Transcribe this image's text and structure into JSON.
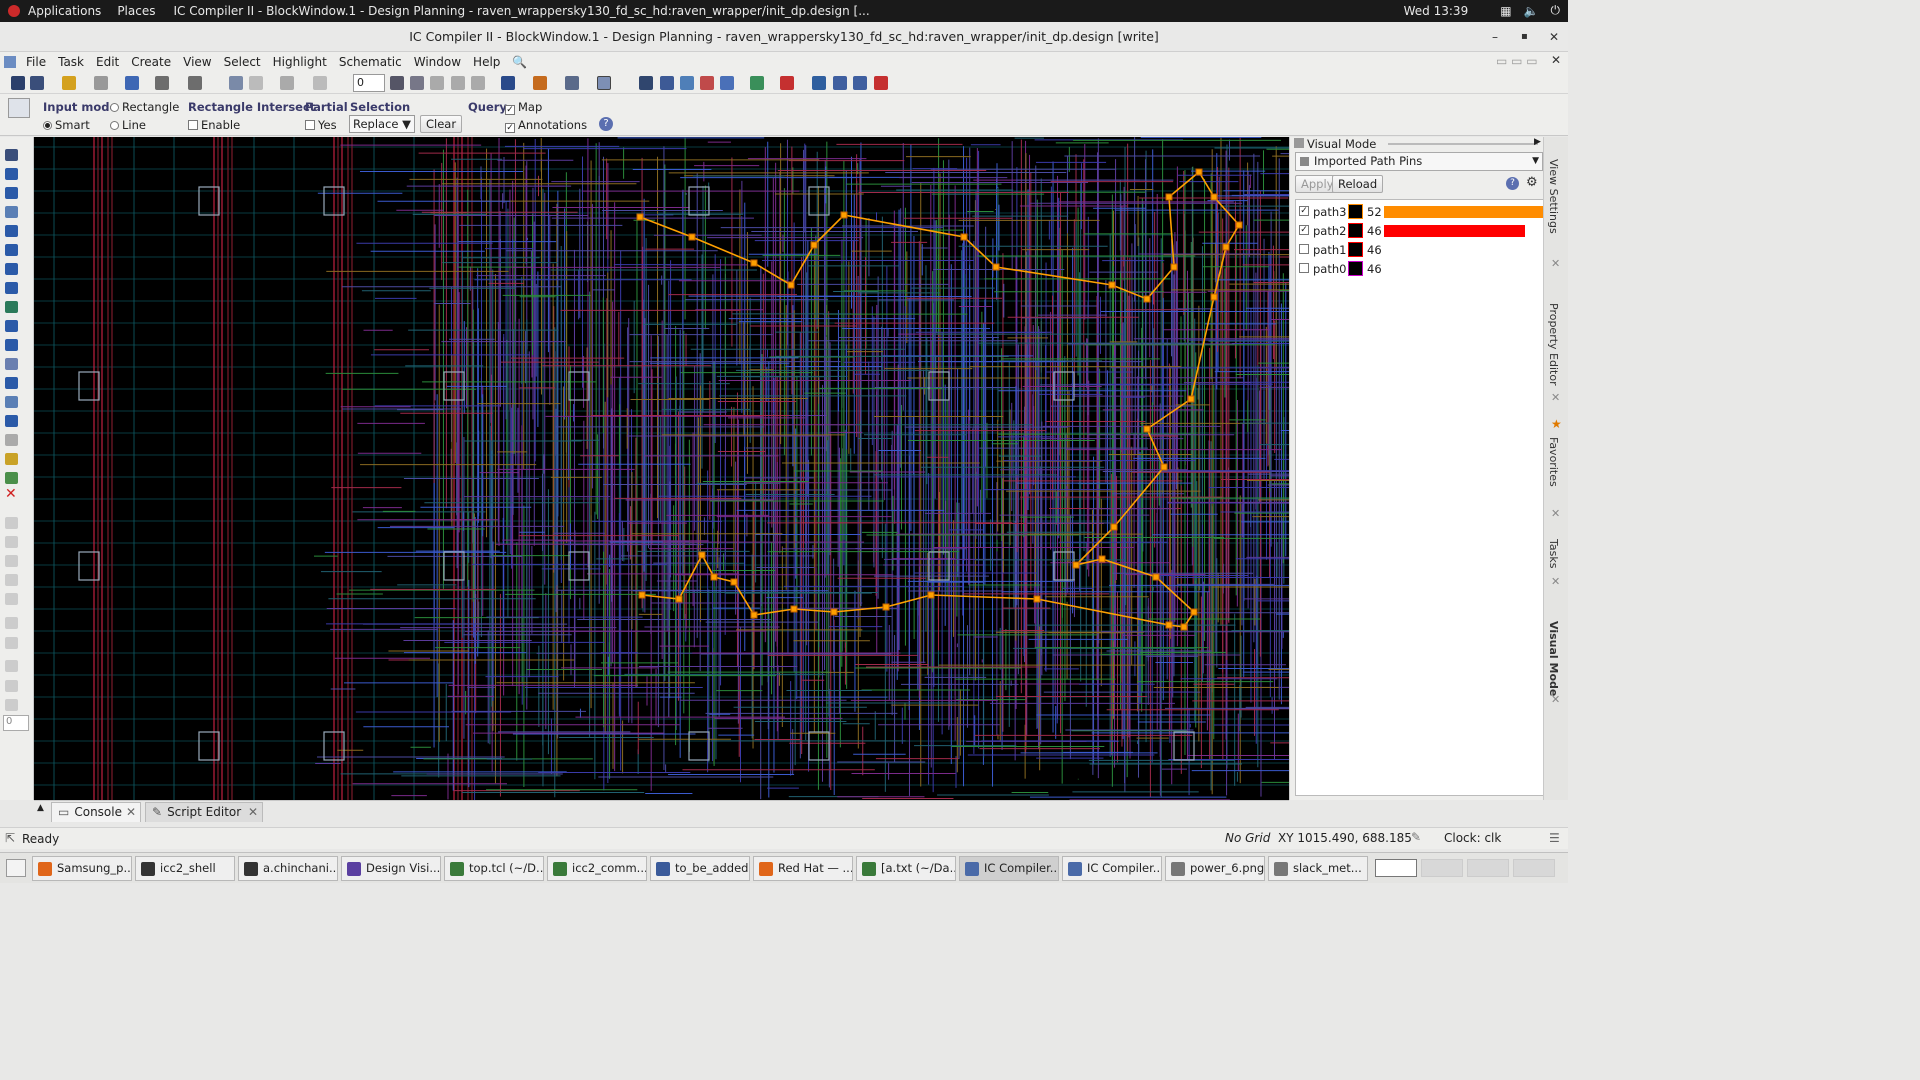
{
  "system_bar": {
    "applications": "Applications",
    "places": "Places",
    "window_title": "IC Compiler II - BlockWindow.1 - Design Planning - raven_wrappersky130_fd_sc_hd:raven_wrapper/init_dp.design [...",
    "clock": "Wed 13:39"
  },
  "window": {
    "title": "IC Compiler II - BlockWindow.1 - Design Planning - raven_wrappersky130_fd_sc_hd:raven_wrapper/init_dp.design [write]"
  },
  "menu": [
    "File",
    "Task",
    "Edit",
    "Create",
    "View",
    "Select",
    "Highlight",
    "Schematic",
    "Window",
    "Help"
  ],
  "toolbar": {
    "layer_value": "0"
  },
  "options": {
    "input_mode_label": "Input mode",
    "rectangle": "Rectangle",
    "smart": "Smart",
    "line": "Line",
    "rect_intersect_label": "Rectangle Intersect",
    "enable": "Enable",
    "partial_label": "Partial",
    "yes": "Yes",
    "selection_label": "Selection",
    "selection_value": "Replace",
    "clear": "Clear",
    "query_label": "Query",
    "map": "Map",
    "annotations": "Annotations"
  },
  "palette": {
    "spin_value": "0"
  },
  "visual_mode": {
    "header": "Visual Mode",
    "mode_select": "Imported Path Pins",
    "apply": "Apply",
    "reload": "Reload",
    "paths": [
      {
        "name": "path3",
        "checked": true,
        "count": "52",
        "color": "#ff8c00",
        "fill": 1.0
      },
      {
        "name": "path2",
        "checked": true,
        "count": "46",
        "color": "#ff0000",
        "fill": 0.88
      },
      {
        "name": "path1",
        "checked": false,
        "count": "46",
        "color": "#ff0000",
        "fill": 0
      },
      {
        "name": "path0",
        "checked": false,
        "count": "46",
        "color": "#cc00cc",
        "fill": 0
      }
    ]
  },
  "side_tabs": [
    "View Settings",
    "Property Editor",
    "Favorites",
    "Tasks",
    "Visual Mode"
  ],
  "bottom_tabs": {
    "console": "Console",
    "script_editor": "Script Editor"
  },
  "status": {
    "ready": "Ready",
    "grid": "No Grid",
    "xy": "XY 1015.490, 688.185",
    "clock": "Clock: clk"
  },
  "taskbar": [
    {
      "label": "Samsung_p...",
      "icon": "firefox-icon"
    },
    {
      "label": "icc2_shell",
      "icon": "terminal-icon"
    },
    {
      "label": "a.chinchani...",
      "icon": "terminal-icon"
    },
    {
      "label": "Design Visi...",
      "icon": "dv-icon"
    },
    {
      "label": "top.tcl (~/D...",
      "icon": "editor-icon"
    },
    {
      "label": "icc2_comm...",
      "icon": "editor-icon"
    },
    {
      "label": "to_be_added",
      "icon": "folder-icon"
    },
    {
      "label": "Red Hat — ...",
      "icon": "firefox-icon"
    },
    {
      "label": "[a.txt (~/Da...",
      "icon": "editor-icon"
    },
    {
      "label": "IC Compiler...",
      "icon": "icc-icon"
    },
    {
      "label": "IC Compiler...",
      "icon": "icc-icon"
    },
    {
      "label": "power_6.png",
      "icon": "image-icon"
    },
    {
      "label": "slack_met...",
      "icon": "image-icon"
    }
  ],
  "colors": {
    "path_orange": "#ffa000",
    "layout_bg": "#000000"
  }
}
